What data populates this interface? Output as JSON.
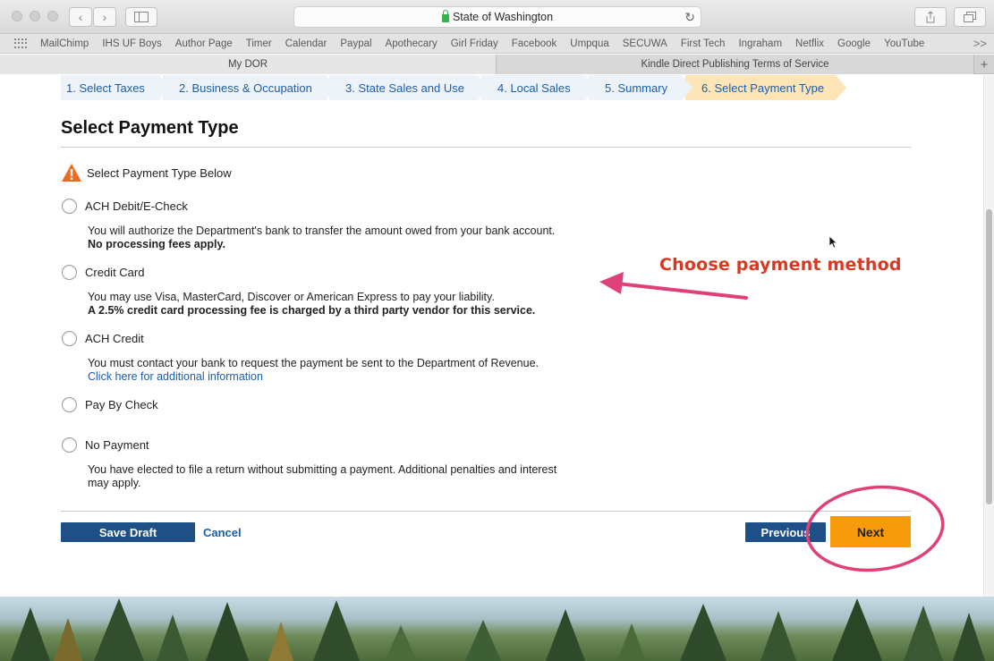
{
  "browser": {
    "address_text": "State of Washington",
    "bookmarks": [
      "MailChimp",
      "IHS UF Boys",
      "Author Page",
      "Timer",
      "Calendar",
      "Paypal",
      "Apothecary",
      "Girl Friday",
      "Facebook",
      "Umpqua",
      "SECUWA",
      "First Tech",
      "Ingraham",
      "Netflix",
      "Google",
      "YouTube"
    ],
    "bookmarks_more": ">>",
    "tabs": [
      "My DOR",
      "Kindle Direct Publishing Terms of Service"
    ],
    "new_tab": "+"
  },
  "steps": [
    {
      "label": "1. Select Taxes",
      "active": false
    },
    {
      "label": "2. Business & Occupation",
      "active": false
    },
    {
      "label": "3. State Sales and Use",
      "active": false
    },
    {
      "label": "4. Local Sales",
      "active": false
    },
    {
      "label": "5. Summary",
      "active": false
    },
    {
      "label": "6. Select Payment Type",
      "active": true
    }
  ],
  "page_title": "Select Payment Type",
  "warning": "Select Payment Type Below",
  "options": {
    "ach_debit": {
      "label": "ACH Debit/E-Check",
      "desc": "You will authorize the Department's bank to transfer the amount owed from your bank account.",
      "desc_bold": "No processing fees apply."
    },
    "credit_card": {
      "label": "Credit Card",
      "desc": "You may use Visa, MasterCard, Discover or American Express to pay your liability.",
      "desc_bold": "A 2.5% credit card processing fee is charged by a third party vendor for this service."
    },
    "ach_credit": {
      "label": "ACH Credit",
      "desc": "You must contact your bank to request the payment be sent to the Department of Revenue.",
      "link": "Click here for additional information"
    },
    "check": {
      "label": "Pay By Check"
    },
    "no_payment": {
      "label": "No Payment",
      "desc_line1": "You have elected to file a return without submitting a payment. Additional penalties and interest",
      "desc_line2": "may apply."
    }
  },
  "buttons": {
    "save_draft": "Save Draft",
    "cancel": "Cancel",
    "previous": "Previous",
    "next": "Next"
  },
  "annotation": {
    "text": "Choose payment method",
    "color": "#d63a22",
    "highlight_color": "#e0407a"
  }
}
